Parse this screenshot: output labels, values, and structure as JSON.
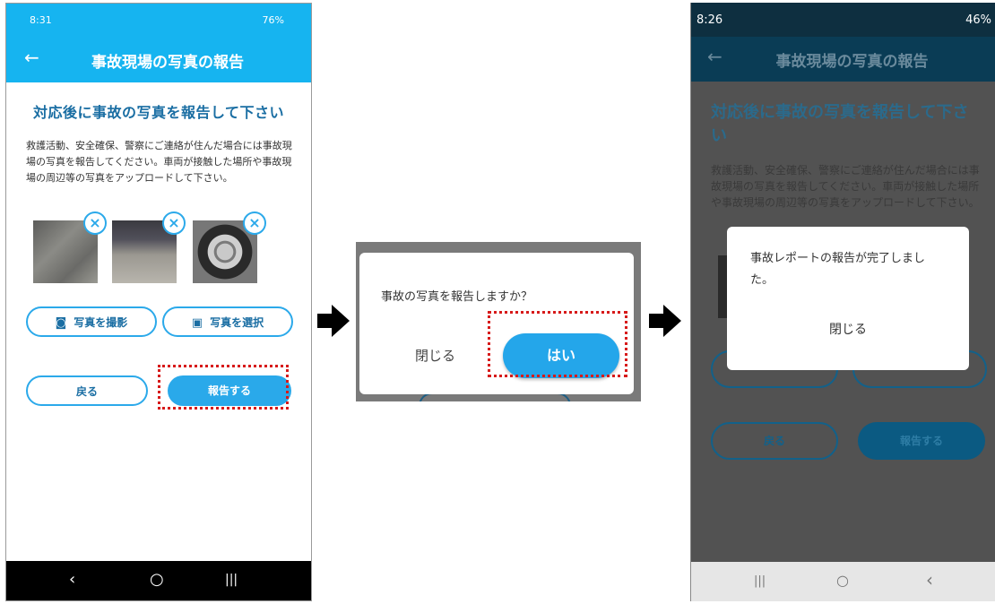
{
  "phone1": {
    "status": {
      "time": "8:31",
      "right": "76%"
    },
    "appbar": {
      "back_icon": "←",
      "title": "事故現場の写真の報告"
    },
    "heading": "対応後に事故の写真を報告して下さい",
    "description": "救護活動、安全確保、警察にご連絡が住んだ場合には事故現場の写真を報告してください。車両が接触した場所や事故現場の周辺等の写真をアップロードして下さい。",
    "remove_icon": "×",
    "take_photo": {
      "icon": "◙",
      "label": "写真を撮影"
    },
    "select_photo": {
      "icon": "▣",
      "label": "写真を選択"
    },
    "back_label": "戻る",
    "report_label": "報告する",
    "nav": {
      "back": "‹",
      "home": "○",
      "recent": "|||"
    }
  },
  "dialog": {
    "question": "事故の写真を報告しますか？",
    "close_label": "閉じる",
    "yes_label": "はい"
  },
  "phone3": {
    "status": {
      "time": "8:26",
      "right": "46%"
    },
    "appbar": {
      "back_icon": "←",
      "title": "事故現場の写真の報告"
    },
    "heading": "対応後に事故の写真を報告して下さい",
    "description": "救護活動、安全確保、警察にご連絡が住んだ場合には事故現場の写真を報告してください。車両が接触した場所や事故現場の周辺等の写真をアップロードして下さい。",
    "back_label": "戻る",
    "report_label": "報告する",
    "done_message": "事故レポートの報告が完了しました。",
    "done_close": "閉じる",
    "nav": {
      "recent": "|||",
      "home": "○",
      "back": "‹"
    }
  },
  "colors": {
    "accent": "#16b4f0",
    "button_blue": "#2aa9ea",
    "highlight_red": "#d71a1a",
    "dim_overlay": "#525252"
  }
}
